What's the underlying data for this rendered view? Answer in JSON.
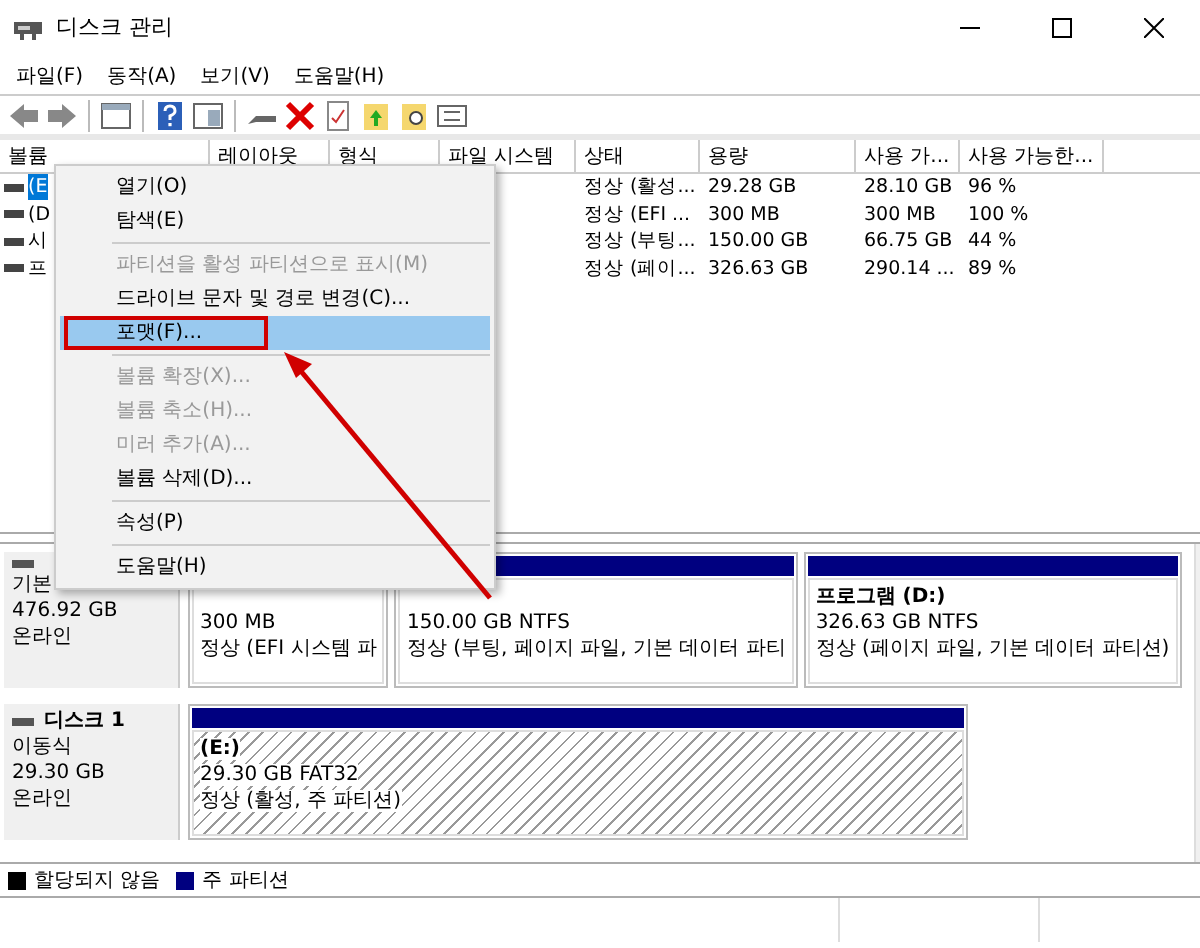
{
  "window": {
    "title": "디스크 관리"
  },
  "menu_bar": [
    "파일(F)",
    "동작(A)",
    "보기(V)",
    "도움말(H)"
  ],
  "table": {
    "columns": [
      "볼륨",
      "레이아웃",
      "형식",
      "파일 시스템",
      "상태",
      "용량",
      "사용 가...",
      "사용 가능한..."
    ],
    "rows": [
      {
        "selected": true,
        "cells": [
          "(E",
          null,
          null,
          null,
          "정상 (활성...",
          "29.28 GB",
          "28.10 GB",
          "96 %"
        ]
      },
      {
        "selected": false,
        "cells": [
          "(D",
          null,
          null,
          null,
          "정상 (EFI ...",
          "300 MB",
          "300 MB",
          "100 %"
        ]
      },
      {
        "selected": false,
        "cells": [
          "시",
          null,
          null,
          null,
          "정상 (부팅...",
          "150.00 GB",
          "66.75 GB",
          "44 %"
        ]
      },
      {
        "selected": false,
        "cells": [
          "프",
          null,
          null,
          null,
          "정상 (페이...",
          "326.63 GB",
          "290.14 ...",
          "89 %"
        ]
      }
    ]
  },
  "context_menu": [
    {
      "kind": "item",
      "label": "열기(O)",
      "disabled": false,
      "selected": false,
      "annotated": false
    },
    {
      "kind": "item",
      "label": "탐색(E)",
      "disabled": false,
      "selected": false,
      "annotated": false
    },
    {
      "kind": "separator"
    },
    {
      "kind": "item",
      "label": "파티션을 활성 파티션으로 표시(M)",
      "disabled": true,
      "selected": false,
      "annotated": false
    },
    {
      "kind": "item",
      "label": "드라이브 문자 및 경로 변경(C)...",
      "disabled": false,
      "selected": false,
      "annotated": false
    },
    {
      "kind": "item",
      "label": "포맷(F)...",
      "disabled": false,
      "selected": true,
      "annotated": true
    },
    {
      "kind": "separator"
    },
    {
      "kind": "item",
      "label": "볼륨 확장(X)...",
      "disabled": true,
      "selected": false,
      "annotated": false
    },
    {
      "kind": "item",
      "label": "볼륨 축소(H)...",
      "disabled": true,
      "selected": false,
      "annotated": false
    },
    {
      "kind": "item",
      "label": "미러 추가(A)...",
      "disabled": true,
      "selected": false,
      "annotated": false
    },
    {
      "kind": "item",
      "label": "볼륨 삭제(D)...",
      "disabled": false,
      "selected": false,
      "annotated": false
    },
    {
      "kind": "separator"
    },
    {
      "kind": "item",
      "label": "속성(P)",
      "disabled": false,
      "selected": false,
      "annotated": false
    },
    {
      "kind": "separator"
    },
    {
      "kind": "item",
      "label": "도움말(H)",
      "disabled": false,
      "selected": false,
      "annotated": false
    }
  ],
  "disks": [
    {
      "info": [
        "기본",
        "476.92 GB",
        "온라인"
      ],
      "partitions": [
        {
          "size": "300 MB",
          "status": "정상 (EFI 시스템 파",
          "selected": false
        },
        {
          "size": "150.00 GB NTFS",
          "status": "정상 (부팅, 페이지 파일, 기본 데이터 파티",
          "selected": false
        },
        {
          "title": "프로그램  (D:)",
          "size": "326.63 GB NTFS",
          "status": "정상 (페이지 파일, 기본 데이터 파티션)",
          "selected": false
        }
      ]
    },
    {
      "name": "디스크 1",
      "info": [
        "이동식",
        "29.30 GB",
        "온라인"
      ],
      "partitions": [
        {
          "title": "(E:)",
          "size": "29.30 GB FAT32",
          "status": "정상 (활성, 주 파티션)",
          "selected": true
        }
      ]
    }
  ],
  "legend": [
    {
      "label": "할당되지 않음",
      "color": "#000000"
    },
    {
      "label": "주 파티션",
      "color": "#000080"
    }
  ]
}
